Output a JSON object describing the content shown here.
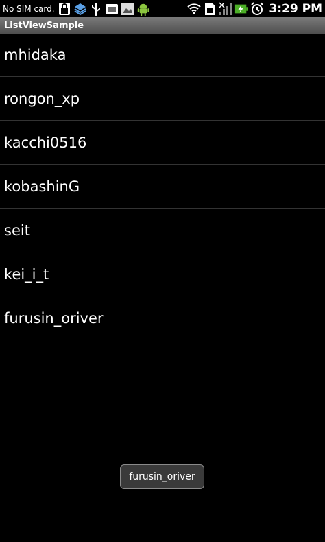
{
  "status_bar": {
    "carrier_text": "No SIM card.",
    "time": "3:29 PM",
    "icons_left": [
      "lock-icon",
      "layers-icon",
      "usb-icon",
      "android-market-icon",
      "image-icon",
      "android-robot-icon"
    ],
    "icons_right": [
      "wifi-icon",
      "sd-card-icon",
      "signal-icon",
      "battery-charging-icon",
      "alarm-icon"
    ]
  },
  "title_bar": {
    "title": "ListViewSample"
  },
  "list": {
    "items": [
      {
        "label": "mhidaka"
      },
      {
        "label": "rongon_xp"
      },
      {
        "label": "kacchi0516"
      },
      {
        "label": "kobashinG"
      },
      {
        "label": "seit"
      },
      {
        "label": "kei_i_t"
      },
      {
        "label": "furusin_oriver"
      }
    ]
  },
  "toast": {
    "message": "furusin_oriver"
  },
  "colors": {
    "background": "#000000",
    "title_bar": "#5f5f5f",
    "divider": "#333333",
    "toast_background": "#3a3a3a",
    "battery_green": "#4caf27"
  }
}
